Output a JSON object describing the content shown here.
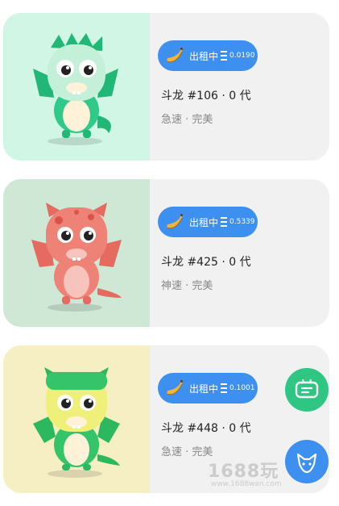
{
  "cards": [
    {
      "status": "出租中",
      "price": "0.0190",
      "title": "斗龙 #106 · 0 代",
      "traits": "急速 · 完美",
      "bg_color": "#d2f6e5",
      "dragon_color": "#2fc98a",
      "dragon_light": "#c4efd8"
    },
    {
      "status": "出租中",
      "price": "0.5339",
      "title": "斗龙 #425 · 0 代",
      "traits": "神速 · 完美",
      "bg_color": "#cfe8d5",
      "dragon_color": "#ef8277",
      "dragon_light": "#f7c4bd"
    },
    {
      "status": "出租中",
      "price": "0.1001",
      "title": "斗龙 #448 · 0 代",
      "traits": "急速 · 完美",
      "bg_color": "#f7efc4",
      "dragon_color": "#35c469",
      "dragon_light": "#eef07a"
    }
  ],
  "fab_chat": {
    "icon": "chat-bubble-icon",
    "color": "#2fc583"
  },
  "fab_blue": {
    "icon": "fox-logo-icon",
    "color": "#3d8ff0"
  },
  "watermark": {
    "text": "1688玩",
    "subtext": "www.1688wan.com"
  },
  "accent": "#3d8ff0"
}
